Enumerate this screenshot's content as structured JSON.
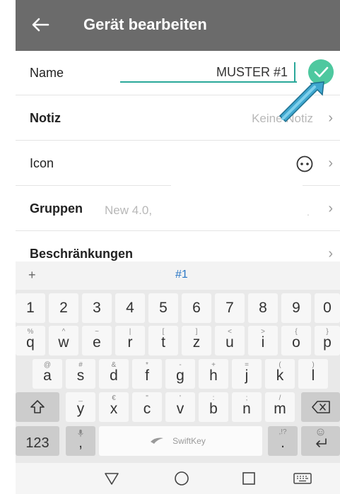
{
  "header": {
    "title": "Gerät bearbeiten"
  },
  "fields": {
    "name": {
      "label": "Name",
      "value": "MUSTER #1"
    },
    "note": {
      "label": "Notiz",
      "value": "Keine Notiz"
    },
    "icon": {
      "label": "Icon"
    },
    "groups": {
      "label": "Gruppen",
      "value": "New 4.0,"
    },
    "restrictions": {
      "label": "Beschränkungen"
    }
  },
  "colors": {
    "appbar": "#6b6b6b",
    "accent": "#2aa89a",
    "confirm": "#4ec89f",
    "arrow": "#2e8fb5"
  },
  "keyboard": {
    "suggest_plus": "+",
    "suggestion": "#1",
    "rows": {
      "numbers": [
        "1",
        "2",
        "3",
        "4",
        "5",
        "6",
        "7",
        "8",
        "9",
        "0"
      ],
      "row1": [
        {
          "main": "q",
          "alt": "%"
        },
        {
          "main": "w",
          "alt": "^"
        },
        {
          "main": "e",
          "alt": "~"
        },
        {
          "main": "r",
          "alt": "|"
        },
        {
          "main": "t",
          "alt": "["
        },
        {
          "main": "z",
          "alt": "]"
        },
        {
          "main": "u",
          "alt": "<"
        },
        {
          "main": "i",
          "alt": ">"
        },
        {
          "main": "o",
          "alt": "{"
        },
        {
          "main": "p",
          "alt": "}"
        }
      ],
      "row2": [
        {
          "main": "a",
          "alt": "@"
        },
        {
          "main": "s",
          "alt": "#"
        },
        {
          "main": "d",
          "alt": "&"
        },
        {
          "main": "f",
          "alt": "*"
        },
        {
          "main": "g",
          "alt": "-"
        },
        {
          "main": "h",
          "alt": "+"
        },
        {
          "main": "j",
          "alt": "="
        },
        {
          "main": "k",
          "alt": "("
        },
        {
          "main": "l",
          "alt": ")"
        }
      ],
      "row3": [
        {
          "main": "y",
          "alt": "_"
        },
        {
          "main": "x",
          "alt": "€"
        },
        {
          "main": "c",
          "alt": "\""
        },
        {
          "main": "v",
          "alt": "'"
        },
        {
          "main": "b",
          "alt": ":"
        },
        {
          "main": "n",
          "alt": ";"
        },
        {
          "main": "m",
          "alt": "/"
        }
      ]
    },
    "mode_label": "123",
    "comma": ",",
    "period": ".",
    "period_alt": ",!?",
    "space_brand": "SwiftKey"
  }
}
